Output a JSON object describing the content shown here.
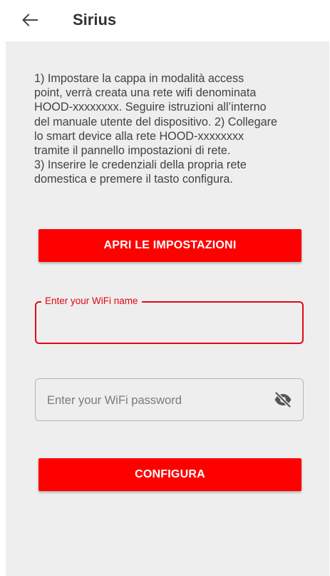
{
  "header": {
    "title": "Sirius",
    "back_icon": "arrow-left-icon"
  },
  "instructions": {
    "text": "1) Impostare la cappa in modalità access\npoint, verrà creata una rete wifi denominata\nHOOD-xxxxxxxx. Seguire istruzioni all’interno\ndel manuale utente del dispositivo. 2) Collegare\nlo smart device alla rete HOOD-xxxxxxxx\ntramite il pannello impostazioni di rete.\n3) Inserire le credenziali della propria rete\ndomestica e premere il tasto configura."
  },
  "settings_button": {
    "label": "APRI LE IMPOSTAZIONI"
  },
  "wifi_name": {
    "label": "Enter your WiFi name",
    "value": ""
  },
  "wifi_password": {
    "placeholder": "Enter your WiFi password",
    "value": "",
    "toggle_icon": "eye-off-icon"
  },
  "configure_button": {
    "label": "CONFIGURA"
  },
  "colors": {
    "accent": "#ff0000",
    "focus_border": "#e30613",
    "panel_bg": "#eeeeee",
    "title_text": "#333333",
    "body_text": "#424242"
  }
}
